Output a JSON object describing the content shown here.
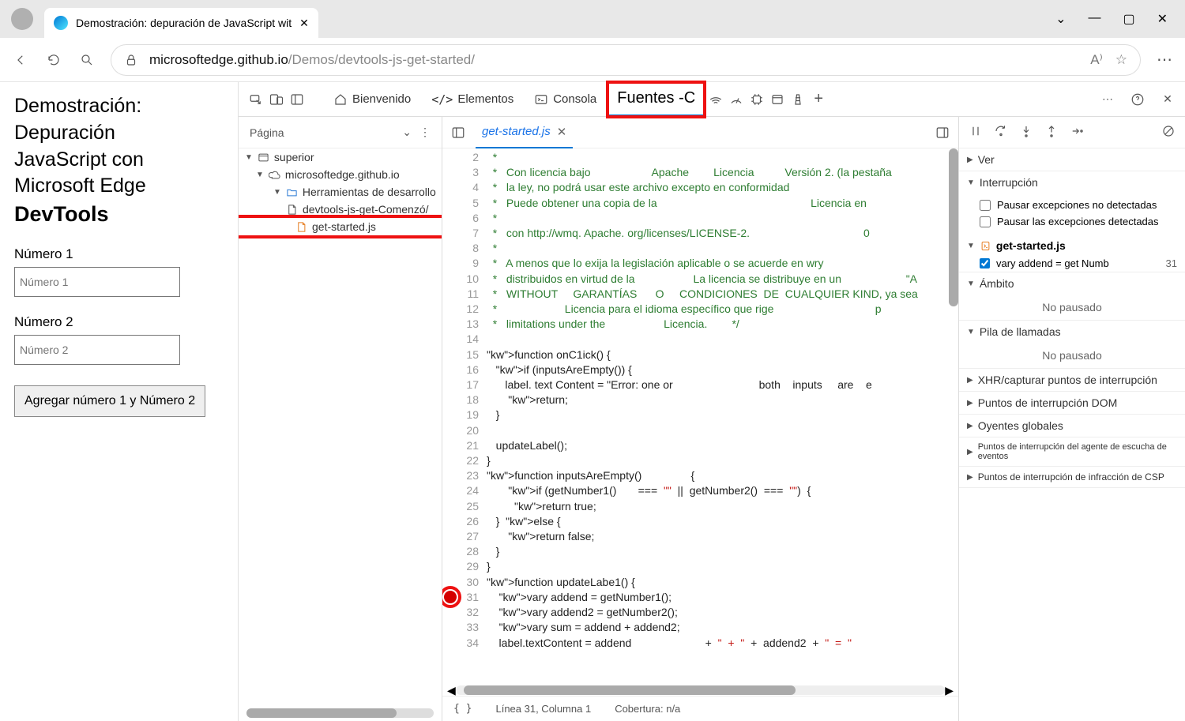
{
  "browser": {
    "tab_title": "Demostración: depuración de JavaScript wit",
    "url_main": "microsoftedge.github.io",
    "url_rest": "/Demos/devtools-js-get-started/"
  },
  "demo": {
    "h_line1": "Demostración: Depuración",
    "h_line2": "JavaScript con",
    "h_line3": "Microsoft Edge",
    "h_bold": "DevTools",
    "label1": "Número   1",
    "ph1": "Número 1",
    "label2": "Número 2",
    "ph2": "Número 2",
    "button": "Agregar número 1 y    Número 2"
  },
  "devtools": {
    "tabs": {
      "welcome": "Bienvenido",
      "elements": "Elementos",
      "console": "Consola",
      "sources": "Fuentes -C"
    },
    "navigator": {
      "page_tab": "Página",
      "top": "superior",
      "origin": "microsoftedge.github.io",
      "folder": "Herramientas de desarrollo",
      "file1": "devtools-js-get-Comenzó/",
      "file2": "get-started.js"
    }
  },
  "editor": {
    "tab": "get-started.js",
    "status_line": "Línea 31, Columna 1",
    "status_cov": "Cobertura: n/a",
    "lines": [
      "  *",
      "  *   Con licencia bajo                    Apache        Licencia          Versión 2. (la pestaña",
      "  *   la ley, no podrá usar este archivo excepto en conformidad",
      "  *   Puede obtener una copia de la                                                  Licencia en",
      "  *",
      "  *   con http://wmq. Apache. org/licenses/LICENSE-2.                                     0",
      "  *",
      "  *   A menos que lo exija la legislación aplicable o se acuerde en wry",
      "  *   distribuidos en virtud de la                   La licencia se distribuye en un                     \"A",
      "  *   WITHOUT     GARANTÍAS      O     CONDICIONES  DE  CUALQUIER KIND, ya sea",
      "  *                      Licencia para el idioma específico que rige                                 p",
      "  *   limitations under the                   Licencia.        */",
      "",
      "function onC1ick() {",
      "   if (inputsAreEmpty()) {",
      "      label. text Content = \"Error: one or                            both    inputs     are    e",
      "       return;",
      "   }",
      "",
      "   updateLabel();",
      "}",
      "function inputsAreEmpty()                {",
      "       if (getNumber1()       ===  \"\"  ||  getNumber2()  ===  \"\")  {",
      "         return true;",
      "   }  else {",
      "       return false;",
      "   }",
      "}",
      "function updateLabe1() {",
      "    vary addend = getNumber1();",
      "    vary addend2 = getNumber2();",
      "    vary sum = addend + addend2;",
      "    label.textContent = addend                        +  \"  +  \"  +  addend2  +  \"  =  \""
    ]
  },
  "debugger": {
    "sections": {
      "watch": "Ver",
      "breakpoints": "Interrupción",
      "pause_uncaught": "Pausar excepciones no detectadas",
      "pause_caught": "Pausar las excepciones detectadas",
      "bp_file": "get-started.js",
      "bp_text": "vary addend = get Numb",
      "bp_num": "31",
      "scope": "Ámbito",
      "not_paused": "No pausado",
      "callstack": "Pila de llamadas",
      "xhr": "XHR/capturar puntos de interrupción",
      "dom": "Puntos de interrupción DOM",
      "global": "Oyentes globales",
      "event": "Puntos de interrupción del agente de escucha de eventos",
      "csp": "Puntos de interrupción de infracción de CSP"
    }
  }
}
